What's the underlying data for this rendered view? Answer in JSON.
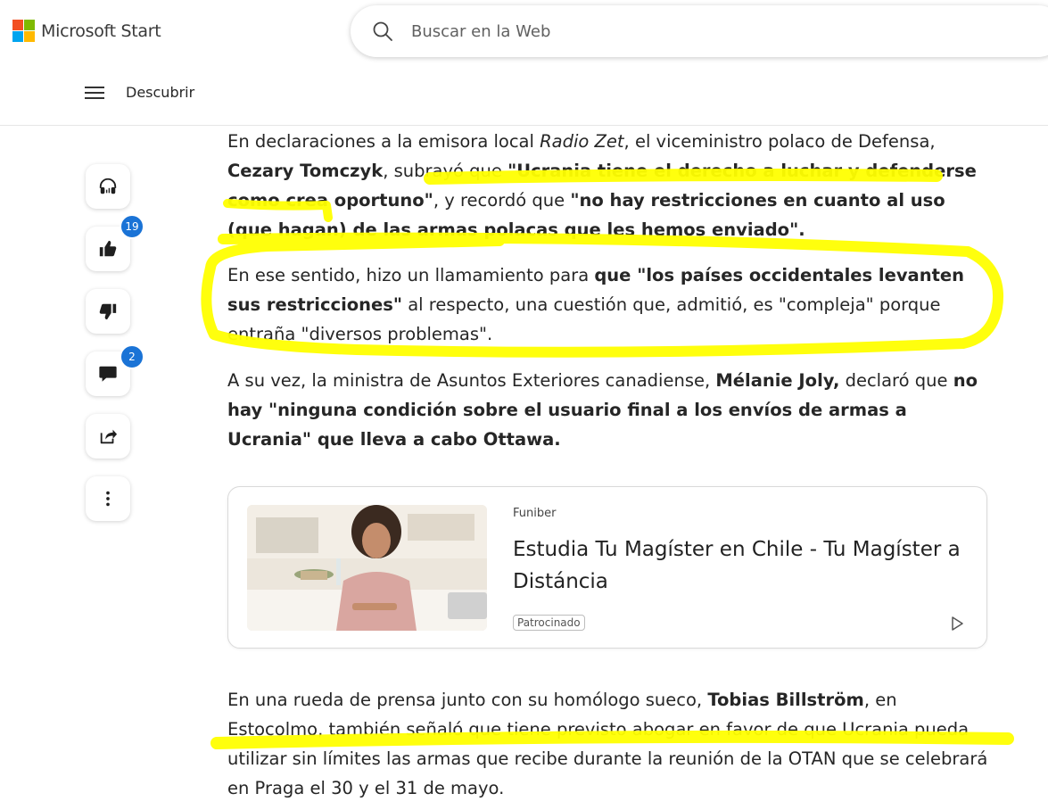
{
  "header": {
    "brand": "Microsoft Start",
    "brand_colors": [
      "#f25022",
      "#7fba00",
      "#00a4ef",
      "#ffb900"
    ],
    "search_placeholder": "Buscar en la Web",
    "nav_label": "Descubrir"
  },
  "sidebar": {
    "like_count": "19",
    "comment_count": "2",
    "badge_color": "#1a73d6",
    "icons": [
      "headphones-icon",
      "thumbs-up-icon",
      "thumbs-down-icon",
      "comment-icon",
      "share-icon",
      "more-icon"
    ]
  },
  "article": {
    "p1": {
      "s1": "En declaraciones a la emisora local ",
      "s2": "Radio Zet",
      "s3": ", el viceministro polaco de Defensa, ",
      "s4": "Cezary Tomczyk",
      "s5": ", subrayó que ",
      "s6": "\"Ucrania tiene el derecho a luchar y defenderse como crea oportuno\"",
      "s7": ", y recordó que ",
      "s8": "\"no hay restricciones en cuanto al uso (que hagan) de las armas polacas que les hemos enviado\"."
    },
    "p2": {
      "s1": "En ese sentido, hizo un llamamiento para ",
      "s2": "que \"los países occidentales levanten sus restricciones\"",
      "s3": " al respecto, una cuestión que, admitió, es \"compleja\" porque entraña \"diversos problemas\"."
    },
    "p3": {
      "s1": "A su vez, la ministra de Asuntos Exteriores canadiense, ",
      "s2": "Mélanie Joly,",
      "s3": " declaró que ",
      "s4": "no hay \"ninguna condición sobre el usuario final a los envíos de armas a Ucrania\" que lleva a cabo Ottawa."
    },
    "p4": {
      "s1": "En una rueda de prensa junto con su homólogo sueco, ",
      "s2": "Tobias Billström",
      "s3": ", en Estocolmo, también señaló que tiene previsto abogar en favor de que Ucrania pueda utilizar sin límites las armas que recibe durante la reunión de la OTAN que se celebrará en Praga el 30 y el 31 de mayo."
    }
  },
  "ad": {
    "source": "Funiber",
    "title": "Estudia Tu Magíster en Chile - Tu Magíster a Distáncia",
    "tag": "Patrocinado"
  },
  "highlight_color": "#ffff00"
}
